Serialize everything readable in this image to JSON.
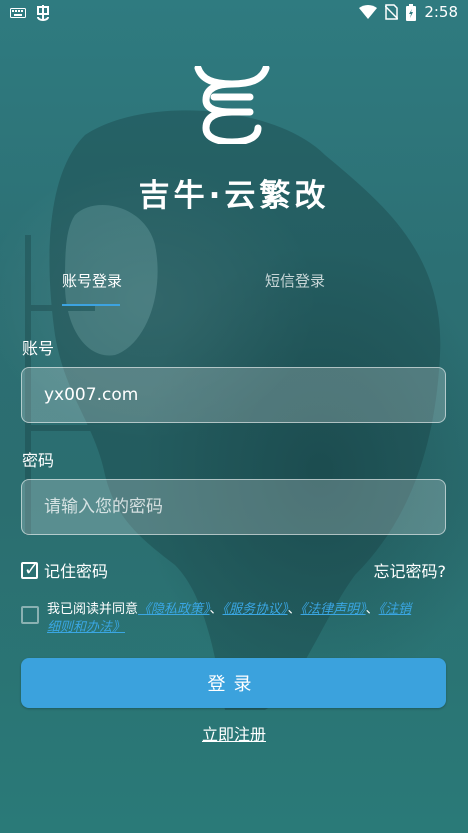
{
  "status_bar": {
    "time": "2:58",
    "icons": [
      "keyboard-icon",
      "bug-icon",
      "wifi-icon",
      "no-sim-icon",
      "battery-charging-icon"
    ]
  },
  "app": {
    "title": "吉牛·云繁改"
  },
  "tabs": [
    {
      "label": "账号登录",
      "active": true
    },
    {
      "label": "短信登录",
      "active": false
    }
  ],
  "form": {
    "account_label": "账号",
    "account_value": "yx007.com",
    "password_label": "密码",
    "password_placeholder": "请输入您的密码",
    "remember_label": "记住密码",
    "remember_checked": true,
    "forgot_label": "忘记密码?"
  },
  "agreement": {
    "prefix": "我已阅读并同意",
    "privacy": "《隐私政策》",
    "sep1": "、",
    "service": "《服务协议》",
    "sep2": "、",
    "legal": "《法律声明》",
    "sep3": "、",
    "cancel": "《注销细则和办法》",
    "checked": false
  },
  "actions": {
    "login_label": "登录",
    "register_label": "立即注册"
  },
  "colors": {
    "accent": "#3ba2dd",
    "tab_indicator": "#3da3e0",
    "link": "#3aa6e3"
  }
}
